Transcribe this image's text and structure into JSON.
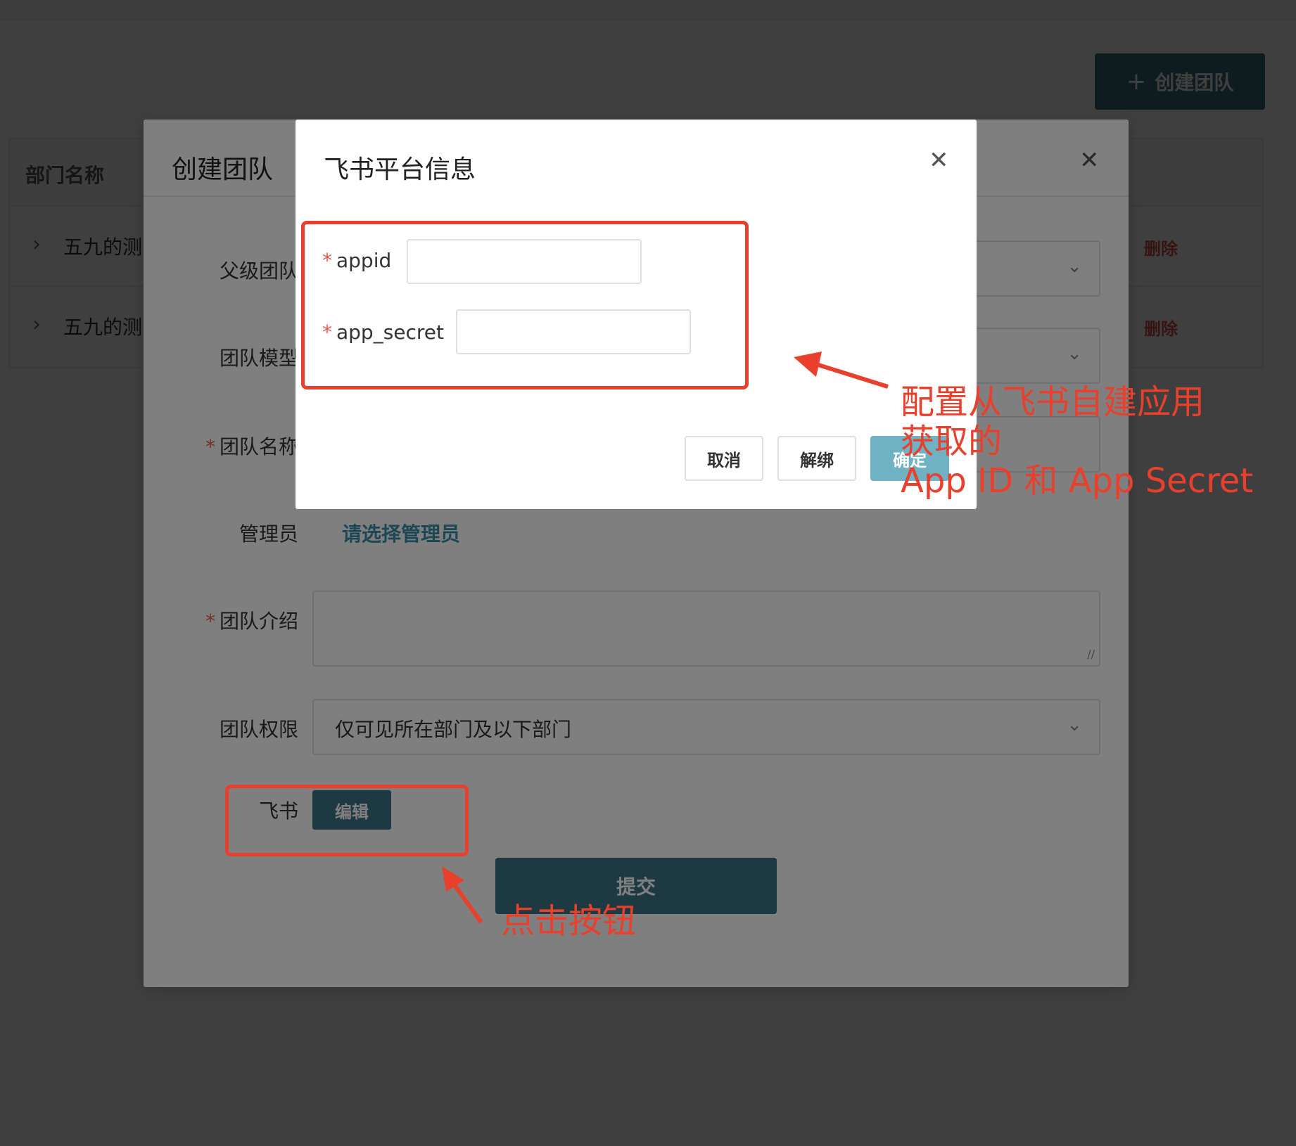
{
  "page": {
    "create_team_button": "创建团队",
    "table": {
      "header_dept_name": "部门名称",
      "rows": [
        {
          "name": "五九的测",
          "action": "删除"
        },
        {
          "name": "五九的测",
          "action": "删除"
        }
      ]
    }
  },
  "create_team_dialog": {
    "title": "创建团队",
    "fields": {
      "parent_team": {
        "label": "父级团队"
      },
      "team_model": {
        "label": "团队模型"
      },
      "team_name": {
        "label": "团队名称",
        "required": true
      },
      "admin": {
        "label": "管理员",
        "link": "请选择管理员"
      },
      "team_intro": {
        "label": "团队介绍",
        "required": true
      },
      "team_permission": {
        "label": "团队权限",
        "value": "仅可见所在部门及以下部门"
      },
      "feishu": {
        "label": "飞书",
        "edit_button": "编辑"
      }
    },
    "submit_button": "提交"
  },
  "feishu_dialog": {
    "title": "飞书平台信息",
    "fields": {
      "appid": {
        "label": "appid",
        "value": ""
      },
      "app_secret": {
        "label": "app_secret",
        "value": ""
      }
    },
    "buttons": {
      "cancel": "取消",
      "unbind": "解绑",
      "confirm": "确定"
    }
  },
  "annotations": {
    "config_note_line1": "配置从飞书自建应用",
    "config_note_line2": "获取的",
    "config_note_line3": "App ID 和 App Secret",
    "click_note": "点击按钮",
    "color": "#e8402d"
  },
  "colors": {
    "primary": "#3a7383",
    "primary_light": "#6fb2c4",
    "danger": "#d9534f",
    "link": "#3a8fa8"
  }
}
